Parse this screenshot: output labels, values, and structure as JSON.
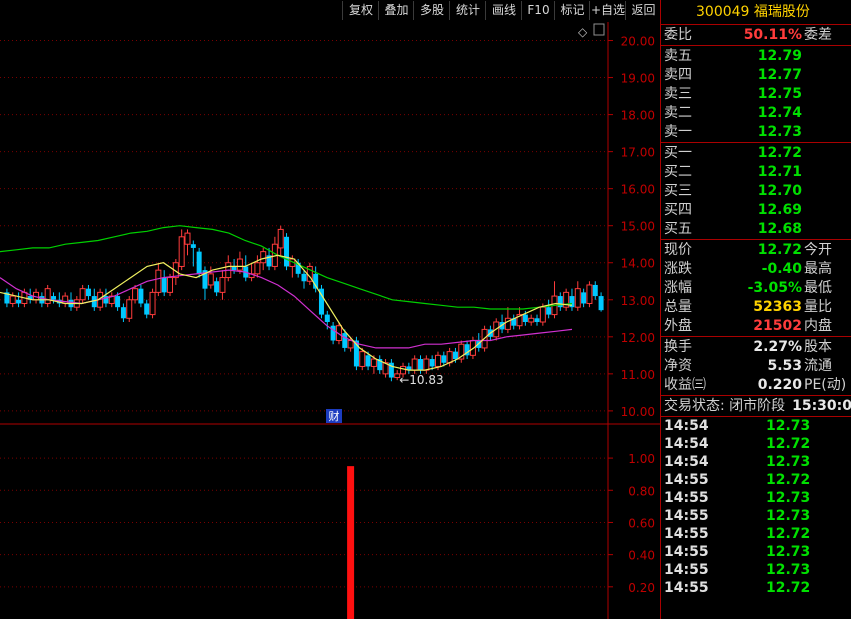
{
  "toolbar": {
    "buttons": [
      "复权",
      "叠加",
      "多股",
      "统计",
      "画线",
      "F10",
      "标记",
      "+自选",
      "返回"
    ]
  },
  "header": {
    "code": "300049",
    "name": "福瑞股份"
  },
  "price_axis": {
    "labels": [
      "20.00",
      "19.00",
      "18.00",
      "17.00",
      "16.00",
      "15.00",
      "14.00",
      "13.00",
      "12.00",
      "11.00",
      "10.00"
    ]
  },
  "volume_axis": {
    "labels": [
      "1.00",
      "0.80",
      "0.60",
      "0.40",
      "0.20"
    ]
  },
  "chart": {
    "low_label": "10.83",
    "event_marker": "财",
    "diamond": "◇"
  },
  "quote": {
    "weibi": {
      "label": "委比",
      "value": "50.11%",
      "label2": "委差"
    },
    "asks": [
      {
        "label": "卖五",
        "price": "12.79"
      },
      {
        "label": "卖四",
        "price": "12.77"
      },
      {
        "label": "卖三",
        "price": "12.75"
      },
      {
        "label": "卖二",
        "price": "12.74"
      },
      {
        "label": "卖一",
        "price": "12.73"
      }
    ],
    "bids": [
      {
        "label": "买一",
        "price": "12.72"
      },
      {
        "label": "买二",
        "price": "12.71"
      },
      {
        "label": "买三",
        "price": "12.70"
      },
      {
        "label": "买四",
        "price": "12.69"
      },
      {
        "label": "买五",
        "price": "12.68"
      }
    ],
    "stats": [
      {
        "label": "现价",
        "value": "12.72",
        "label2": "今开",
        "color": "g"
      },
      {
        "label": "涨跌",
        "value": "-0.40",
        "label2": "最高",
        "color": "g"
      },
      {
        "label": "涨幅",
        "value": "-3.05%",
        "label2": "最低",
        "color": "g"
      },
      {
        "label": "总量",
        "value": "52363",
        "label2": "量比",
        "color": "y"
      },
      {
        "label": "外盘",
        "value": "21502",
        "label2": "内盘",
        "color": "r"
      }
    ],
    "stats2": [
      {
        "label": "换手",
        "value": "2.27%",
        "label2": "股本"
      },
      {
        "label": "净资",
        "value": "5.53",
        "label2": "流通"
      },
      {
        "label": "收益㈢",
        "value": "0.220",
        "label2": "PE(动)"
      }
    ],
    "status": {
      "label": "交易状态:",
      "value": "闭市阶段",
      "time": "15:30:0"
    },
    "ticks": [
      {
        "time": "14:54",
        "price": "12.73"
      },
      {
        "time": "14:54",
        "price": "12.72"
      },
      {
        "time": "14:54",
        "price": "12.73"
      },
      {
        "time": "14:55",
        "price": "12.72"
      },
      {
        "time": "14:55",
        "price": "12.73"
      },
      {
        "time": "14:55",
        "price": "12.73"
      },
      {
        "time": "14:55",
        "price": "12.72"
      },
      {
        "time": "14:55",
        "price": "12.73"
      },
      {
        "time": "14:55",
        "price": "12.73"
      },
      {
        "time": "14:55",
        "price": "12.72"
      }
    ]
  },
  "chart_data": {
    "type": "candlestick",
    "ylim": [
      9.7,
      20.5
    ],
    "candles": [
      [
        13.2,
        12.9,
        13.3,
        12.8
      ],
      [
        12.9,
        13.1,
        13.2,
        12.8
      ],
      [
        13.0,
        12.9,
        13.2,
        12.8
      ],
      [
        12.9,
        13.2,
        13.3,
        12.8
      ],
      [
        13.1,
        13.0,
        13.3,
        12.9
      ],
      [
        13.0,
        13.2,
        13.3,
        12.9
      ],
      [
        13.1,
        12.9,
        13.2,
        12.8
      ],
      [
        12.9,
        13.3,
        13.4,
        12.8
      ],
      [
        13.1,
        13.0,
        13.2,
        12.9
      ],
      [
        13.0,
        12.9,
        13.2,
        12.8
      ],
      [
        12.9,
        13.1,
        13.2,
        12.8
      ],
      [
        13.0,
        12.8,
        13.2,
        12.7
      ],
      [
        12.8,
        13.0,
        13.1,
        12.7
      ],
      [
        13.0,
        13.3,
        13.4,
        12.9
      ],
      [
        13.3,
        13.1,
        13.4,
        13.0
      ],
      [
        13.1,
        12.8,
        13.3,
        12.7
      ],
      [
        12.8,
        13.2,
        13.3,
        12.7
      ],
      [
        13.1,
        12.9,
        13.3,
        12.8
      ],
      [
        12.9,
        13.1,
        13.2,
        12.8
      ],
      [
        13.1,
        12.8,
        13.2,
        12.7
      ],
      [
        12.8,
        12.5,
        12.9,
        12.4
      ],
      [
        12.5,
        13.0,
        13.1,
        12.4
      ],
      [
        13.0,
        13.3,
        13.4,
        12.9
      ],
      [
        13.3,
        12.9,
        13.4,
        12.8
      ],
      [
        12.9,
        12.6,
        13.0,
        12.5
      ],
      [
        12.6,
        13.2,
        13.3,
        12.5
      ],
      [
        13.2,
        13.8,
        14.0,
        13.1
      ],
      [
        13.6,
        13.2,
        13.8,
        13.1
      ],
      [
        13.2,
        13.6,
        13.7,
        13.1
      ],
      [
        13.6,
        14.0,
        14.1,
        13.4
      ],
      [
        13.9,
        14.7,
        14.9,
        13.8
      ],
      [
        14.5,
        14.8,
        14.9,
        14.2
      ],
      [
        14.5,
        14.4,
        14.6,
        13.9
      ],
      [
        14.3,
        13.7,
        14.4,
        13.6
      ],
      [
        13.8,
        13.3,
        13.9,
        13.0
      ],
      [
        13.4,
        13.7,
        13.9,
        13.3
      ],
      [
        13.5,
        13.2,
        13.6,
        13.1
      ],
      [
        13.2,
        13.6,
        13.8,
        13.0
      ],
      [
        13.6,
        14.0,
        14.2,
        13.5
      ],
      [
        13.9,
        13.8,
        14.1,
        13.7
      ],
      [
        13.8,
        14.1,
        14.3,
        13.7
      ],
      [
        13.9,
        13.6,
        14.2,
        13.5
      ],
      [
        13.6,
        13.7,
        14.0,
        13.5
      ],
      [
        13.7,
        14.0,
        14.2,
        13.6
      ],
      [
        14.0,
        14.3,
        14.4,
        13.8
      ],
      [
        14.2,
        13.9,
        14.4,
        13.8
      ],
      [
        13.9,
        14.5,
        14.7,
        13.8
      ],
      [
        14.4,
        14.9,
        15.0,
        14.2
      ],
      [
        14.7,
        13.9,
        14.8,
        13.8
      ],
      [
        13.9,
        14.1,
        14.2,
        13.6
      ],
      [
        14.0,
        13.7,
        14.1,
        13.6
      ],
      [
        13.7,
        13.5,
        13.8,
        13.3
      ],
      [
        13.5,
        13.9,
        14.0,
        13.4
      ],
      [
        13.7,
        13.3,
        13.9,
        13.2
      ],
      [
        13.3,
        12.6,
        13.4,
        12.5
      ],
      [
        12.6,
        12.4,
        12.7,
        12.2
      ],
      [
        12.3,
        11.9,
        12.4,
        11.8
      ],
      [
        11.9,
        12.3,
        12.4,
        11.8
      ],
      [
        12.1,
        11.7,
        12.2,
        11.6
      ],
      [
        11.7,
        11.9,
        12.0,
        11.6
      ],
      [
        11.9,
        11.2,
        12.0,
        11.1
      ],
      [
        11.2,
        11.6,
        11.7,
        11.1
      ],
      [
        11.5,
        11.2,
        11.6,
        11.1
      ],
      [
        11.2,
        11.4,
        11.5,
        11.0
      ],
      [
        11.4,
        11.1,
        11.5,
        11.0
      ],
      [
        11.0,
        11.3,
        11.4,
        10.9
      ],
      [
        11.3,
        10.9,
        11.4,
        10.8
      ],
      [
        10.9,
        11.0,
        11.1,
        10.83
      ],
      [
        11.0,
        11.2,
        11.3,
        10.9
      ],
      [
        11.2,
        11.1,
        11.3,
        11.0
      ],
      [
        11.1,
        11.4,
        11.5,
        11.0
      ],
      [
        11.4,
        11.1,
        11.5,
        11.0
      ],
      [
        11.1,
        11.4,
        11.5,
        11.0
      ],
      [
        11.4,
        11.2,
        11.5,
        11.1
      ],
      [
        11.2,
        11.5,
        11.6,
        11.1
      ],
      [
        11.5,
        11.3,
        11.6,
        11.2
      ],
      [
        11.3,
        11.6,
        11.7,
        11.2
      ],
      [
        11.6,
        11.4,
        11.7,
        11.3
      ],
      [
        11.4,
        11.8,
        11.9,
        11.3
      ],
      [
        11.8,
        11.5,
        11.9,
        11.4
      ],
      [
        11.5,
        11.9,
        12.0,
        11.4
      ],
      [
        11.9,
        11.7,
        12.1,
        11.6
      ],
      [
        11.7,
        12.2,
        12.3,
        11.6
      ],
      [
        12.2,
        12.0,
        12.3,
        11.9
      ],
      [
        12.0,
        12.4,
        12.5,
        11.9
      ],
      [
        12.4,
        12.2,
        12.6,
        12.1
      ],
      [
        12.2,
        12.5,
        12.8,
        12.1
      ],
      [
        12.5,
        12.3,
        12.6,
        12.2
      ],
      [
        12.3,
        12.6,
        12.8,
        12.2
      ],
      [
        12.6,
        12.4,
        12.7,
        12.3
      ],
      [
        12.4,
        12.5,
        12.6,
        12.3
      ],
      [
        12.5,
        12.4,
        12.6,
        12.3
      ],
      [
        12.4,
        12.8,
        12.9,
        12.3
      ],
      [
        12.8,
        12.6,
        13.0,
        12.5
      ],
      [
        12.6,
        13.1,
        13.5,
        12.5
      ],
      [
        13.1,
        12.8,
        13.2,
        12.7
      ],
      [
        12.8,
        13.2,
        13.3,
        12.7
      ],
      [
        13.1,
        12.8,
        13.3,
        12.7
      ],
      [
        12.8,
        13.3,
        13.5,
        12.7
      ],
      [
        13.2,
        12.9,
        13.3,
        12.8
      ],
      [
        12.9,
        13.4,
        13.5,
        12.8
      ],
      [
        13.4,
        13.1,
        13.5,
        13.0
      ],
      [
        13.1,
        12.72,
        13.2,
        12.68
      ]
    ],
    "ma_yellow": [
      13.2,
      13.1,
      13.0,
      13.0,
      12.9,
      12.9,
      13.0,
      13.3,
      13.6,
      13.9,
      14.0,
      13.7,
      13.6,
      13.8,
      13.9,
      13.9,
      14.1,
      14.2,
      14.1,
      13.6,
      12.9,
      12.2,
      11.7,
      11.4,
      11.2,
      11.1,
      11.1,
      11.2,
      11.4,
      11.7,
      12.1,
      12.4,
      12.6,
      12.8,
      12.9,
      12.85
    ],
    "ma_purple": [
      13.6,
      13.3,
      13.1,
      13.0,
      12.95,
      12.9,
      13.0,
      13.1,
      13.3,
      13.5,
      13.6,
      13.65,
      13.7,
      13.75,
      13.8,
      13.75,
      13.6,
      13.4,
      13.1,
      12.7,
      12.3,
      12.0,
      11.8,
      11.7,
      11.7,
      11.7,
      11.8,
      11.8,
      11.85,
      11.9,
      11.9,
      12.0,
      12.05,
      12.1,
      12.15,
      12.2
    ],
    "ma_green": [
      14.3,
      14.35,
      14.4,
      14.4,
      14.5,
      14.55,
      14.6,
      14.7,
      14.8,
      14.85,
      14.95,
      15.0,
      14.95,
      14.9,
      14.8,
      14.6,
      14.45,
      14.2,
      14.0,
      13.8,
      13.6,
      13.45,
      13.3,
      13.15,
      13.0,
      12.95,
      12.9,
      12.85,
      12.8,
      12.8,
      12.75,
      12.75,
      12.75,
      12.8,
      12.85,
      12.9
    ],
    "volume": {
      "index": 59,
      "value": 0.95,
      "ylim": [
        0,
        1.1
      ]
    }
  }
}
